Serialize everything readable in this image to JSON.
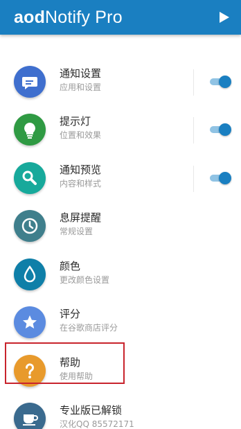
{
  "app": {
    "title_bold": "aod",
    "title_rest": "Notify Pro",
    "bar_color": "#1a7fc1",
    "play_icon": "play-icon"
  },
  "items": [
    {
      "title": "通知设置",
      "subtitle": "应用和设置",
      "color": "#3f6fce",
      "icon": "message-icon",
      "toggle": true
    },
    {
      "title": "提示灯",
      "subtitle": "位置和效果",
      "color": "#2f9a43",
      "icon": "bulb-icon",
      "toggle": true
    },
    {
      "title": "通知预览",
      "subtitle": "内容和样式",
      "color": "#17a99b",
      "icon": "search-icon",
      "toggle": true
    },
    {
      "title": "息屏提醒",
      "subtitle": "常规设置",
      "color": "#3f7f8c",
      "icon": "clock-icon",
      "toggle": false
    },
    {
      "title": "颜色",
      "subtitle": "更改颜色设置",
      "color": "#0f7fa8",
      "icon": "drop-icon",
      "toggle": false
    },
    {
      "title": "评分",
      "subtitle": "在谷歌商店评分",
      "color": "#5b8be0",
      "icon": "star-icon",
      "toggle": false
    },
    {
      "title": "帮助",
      "subtitle": "使用帮助",
      "color": "#e89a2c",
      "icon": "question-icon",
      "toggle": false
    },
    {
      "title": "专业版已解锁",
      "subtitle": "汉化QQ 85572171",
      "color": "#3a6a8e",
      "icon": "cup-icon",
      "toggle": false
    }
  ],
  "highlight_color": "#c8232c"
}
